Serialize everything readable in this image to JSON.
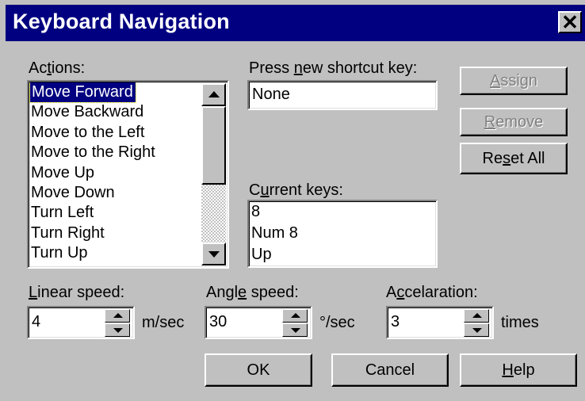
{
  "window": {
    "title": "Keyboard Navigation",
    "close_glyph": "✕"
  },
  "actions": {
    "label": "Actions:",
    "items": [
      "Move Forward",
      "Move Backward",
      "Move to the Left",
      "Move to the Right",
      "Move Up",
      "Move Down",
      "Turn Left",
      "Turn Right",
      "Turn Up"
    ],
    "selected": "Move Forward"
  },
  "shortcut": {
    "label": "Press new shortcut key:",
    "value": "None"
  },
  "current_keys": {
    "label": "Current keys:",
    "items": [
      "8",
      "Num 8",
      "Up"
    ]
  },
  "buttons": {
    "assign": "Assign",
    "remove": "Remove",
    "reset_all": "Reset All",
    "ok": "OK",
    "cancel": "Cancel",
    "help": "Help"
  },
  "linear_speed": {
    "label": "Linear speed:",
    "value": "4",
    "unit": "m/sec"
  },
  "angle_speed": {
    "label": "Angle speed:",
    "value": "30",
    "unit": "°/sec"
  },
  "acceleration": {
    "label": "Accelaration:",
    "value": "3",
    "unit": "times"
  },
  "colors": {
    "titlebar": "#000080",
    "face": "#c0c0c0",
    "selection": "#000080"
  }
}
